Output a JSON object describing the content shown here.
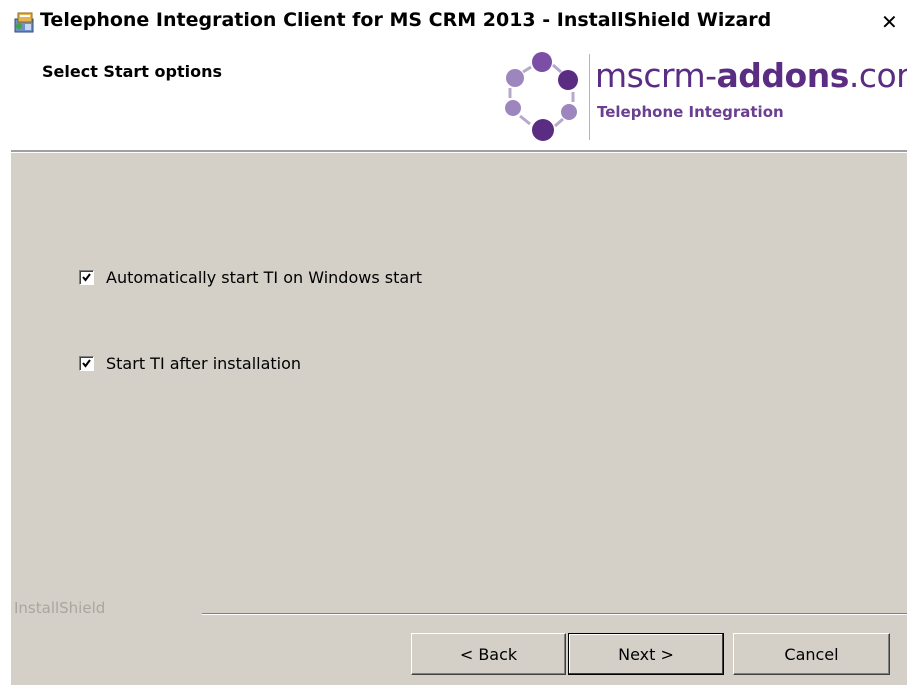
{
  "window": {
    "title": "Telephone Integration Client for MS CRM 2013 - InstallShield Wizard",
    "close_glyph": "✕",
    "icon": "installer-icon"
  },
  "banner": {
    "title": "Select Start options",
    "logo": {
      "name_light": "mscrm-",
      "name_bold": "addons",
      "name_suffix": ".com",
      "subtitle": "Telephone Integration",
      "icon": "mscrm-addons-logo-icon",
      "color": "#5a2d83"
    }
  },
  "options": [
    {
      "label": "Automatically start TI on Windows start",
      "checked": true
    },
    {
      "label": "Start TI after installation",
      "checked": true
    }
  ],
  "footer": {
    "brand": "InstallShield",
    "buttons": {
      "back": "< Back",
      "next": "Next >",
      "cancel": "Cancel"
    }
  },
  "colors": {
    "dialog_bg": "#d4d0c8",
    "banner_bg": "#ffffff"
  }
}
